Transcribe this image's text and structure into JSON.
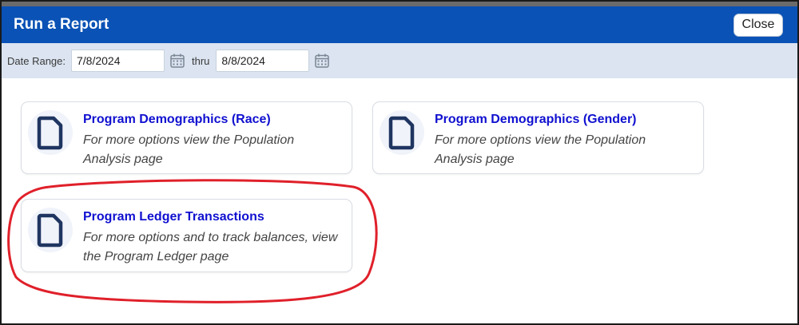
{
  "dialog": {
    "title": "Run a Report",
    "close_label": "Close"
  },
  "filters": {
    "date_range_label": "Date Range:",
    "start_date": "7/8/2024",
    "thru_label": "thru",
    "end_date": "8/8/2024"
  },
  "reports": [
    {
      "title": "Program Demographics (Race)",
      "desc_line1": "For more options view the Population",
      "desc_line2": "Analysis page"
    },
    {
      "title": "Program Demographics (Gender)",
      "desc_line1": "For more options view the Population",
      "desc_line2": "Analysis page"
    },
    {
      "title": "Program Ledger Transactions",
      "desc_line1": "For more options and to track balances, view",
      "desc_line2": "the Program Ledger page"
    }
  ],
  "colors": {
    "title_bar": "#0a52b5",
    "filter_bar": "#dbe4f0",
    "link": "#1010d0",
    "doc_icon": "#1f3561",
    "annotation": "#e0202a"
  }
}
